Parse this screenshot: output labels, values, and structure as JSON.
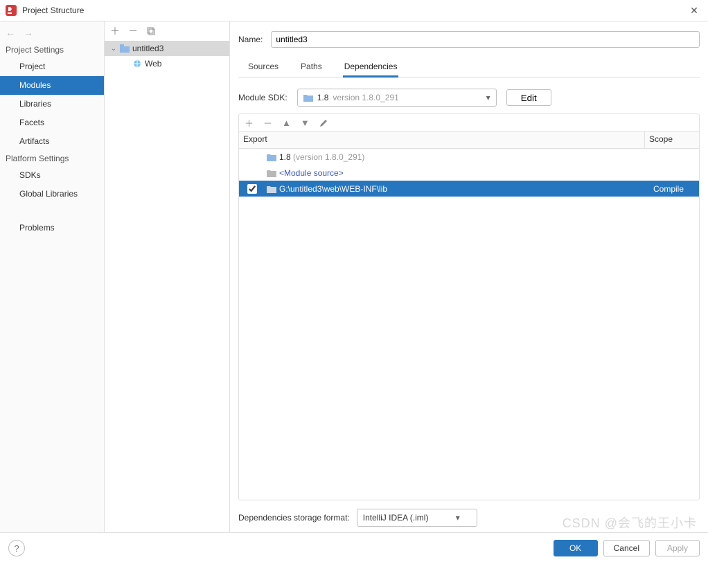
{
  "window": {
    "title": "Project Structure"
  },
  "sidebar": {
    "sections": {
      "project": "Project Settings",
      "platform": "Platform Settings"
    },
    "items": {
      "project": "Project",
      "modules": "Modules",
      "libraries": "Libraries",
      "facets": "Facets",
      "artifacts": "Artifacts",
      "sdks": "SDKs",
      "global_libraries": "Global Libraries",
      "problems": "Problems"
    }
  },
  "tree": {
    "root": "untitled3",
    "child": "Web"
  },
  "main": {
    "name_label": "Name:",
    "name_value": "untitled3",
    "tabs": {
      "sources": "Sources",
      "paths": "Paths",
      "dependencies": "Dependencies"
    },
    "sdk_label": "Module SDK:",
    "sdk_name": "1.8",
    "sdk_version": "version 1.8.0_291",
    "edit_label": "Edit",
    "columns": {
      "export": "Export",
      "scope": "Scope"
    },
    "rows": [
      {
        "type": "sdk",
        "text": "1.8",
        "suffix": "(version 1.8.0_291)"
      },
      {
        "type": "source",
        "text": "<Module source>"
      },
      {
        "type": "lib",
        "text": "G:\\untitled3\\web\\WEB-INF\\lib",
        "checked": true,
        "scope": "Compile"
      }
    ],
    "storage_label": "Dependencies storage format:",
    "storage_value": "IntelliJ IDEA (.iml)"
  },
  "buttons": {
    "ok": "OK",
    "cancel": "Cancel",
    "apply": "Apply"
  },
  "watermark": "CSDN @会飞的王小卡"
}
